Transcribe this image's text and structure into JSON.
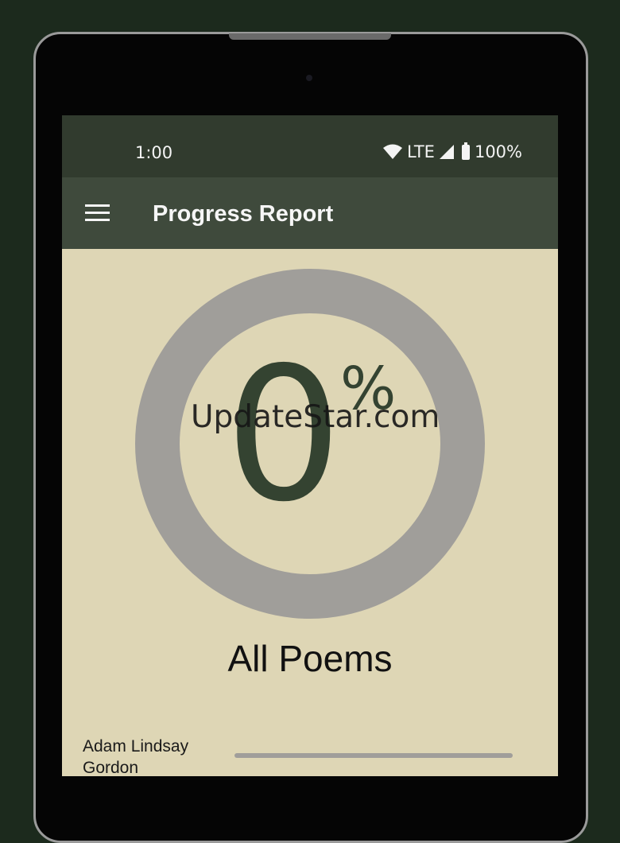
{
  "status_bar": {
    "time": "1:00",
    "network": "LTE",
    "battery": "100%"
  },
  "app_bar": {
    "title": "Progress Report",
    "menu_icon": "hamburger-menu-icon"
  },
  "progress": {
    "value": "0",
    "symbol": "%",
    "fraction": 0
  },
  "watermark": "UpdateStar.com",
  "section_title": "All Poems",
  "poets": [
    {
      "name": "Adam Lindsay Gordon",
      "progress": 0
    }
  ],
  "colors": {
    "status_bar": "#313b2e",
    "app_bar": "#3f4a3c",
    "background": "#ded6b5",
    "ring": "#a09e9a",
    "accent_text": "#344331"
  }
}
